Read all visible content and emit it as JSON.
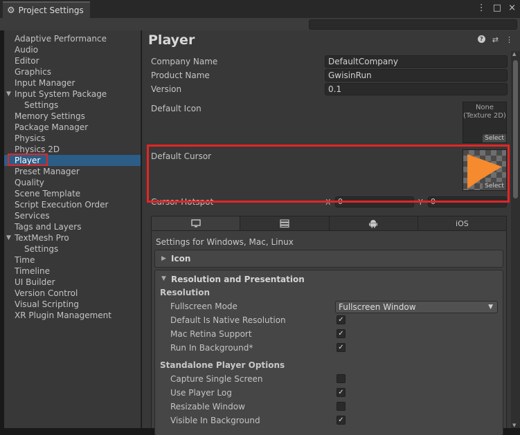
{
  "window": {
    "tab_title": "Project Settings",
    "controls": [
      "⋮",
      "□",
      "×"
    ]
  },
  "search": {
    "placeholder": ""
  },
  "sidebar": {
    "items": [
      {
        "label": "Adaptive Performance"
      },
      {
        "label": "Audio"
      },
      {
        "label": "Editor"
      },
      {
        "label": "Graphics"
      },
      {
        "label": "Input Manager"
      },
      {
        "label": "Input System Package",
        "expanded": true
      },
      {
        "label": "Settings",
        "sub": true
      },
      {
        "label": "Memory Settings"
      },
      {
        "label": "Package Manager"
      },
      {
        "label": "Physics"
      },
      {
        "label": "Physics 2D"
      },
      {
        "label": "Player",
        "selected": true
      },
      {
        "label": "Preset Manager"
      },
      {
        "label": "Quality"
      },
      {
        "label": "Scene Template"
      },
      {
        "label": "Script Execution Order"
      },
      {
        "label": "Services"
      },
      {
        "label": "Tags and Layers"
      },
      {
        "label": "TextMesh Pro",
        "expanded": true
      },
      {
        "label": "Settings",
        "sub": true
      },
      {
        "label": "Time"
      },
      {
        "label": "Timeline"
      },
      {
        "label": "UI Builder"
      },
      {
        "label": "Version Control"
      },
      {
        "label": "Visual Scripting"
      },
      {
        "label": "XR Plugin Management"
      }
    ]
  },
  "player": {
    "title": "Player",
    "company_name_label": "Company Name",
    "company_name_value": "DefaultCompany",
    "product_name_label": "Product Name",
    "product_name_value": "GwisinRun",
    "version_label": "Version",
    "version_value": "0.1",
    "default_icon_label": "Default Icon",
    "default_icon_none": "None\n(Texture 2D)",
    "select_label": "Select",
    "default_cursor_label": "Default Cursor",
    "cursor_hotspot_label": "Cursor Hotspot",
    "hotspot_x_label": "X",
    "hotspot_x_value": "0",
    "hotspot_y_label": "Y",
    "hotspot_y_value": "0"
  },
  "platform_tabs": {
    "ios_label": "iOS",
    "settings_for": "Settings for Windows, Mac, Linux"
  },
  "sections": {
    "icon_title": "Icon",
    "resolution_title": "Resolution and Presentation",
    "resolution_group": "Resolution",
    "fullscreen_mode_label": "Fullscreen Mode",
    "fullscreen_mode_value": "Fullscreen Window",
    "standalone_group": "Standalone Player Options",
    "resolution_props": [
      {
        "label": "Default Is Native Resolution",
        "checked": true
      },
      {
        "label": "Mac Retina Support",
        "checked": true
      },
      {
        "label": "Run In Background*",
        "checked": true
      }
    ],
    "standalone_props": [
      {
        "label": "Capture Single Screen",
        "checked": false
      },
      {
        "label": "Use Player Log",
        "checked": true
      },
      {
        "label": "Resizable Window",
        "checked": false
      },
      {
        "label": "Visible In Background",
        "checked": true
      }
    ]
  },
  "colors": {
    "selection": "#2c5d87",
    "highlight_red": "#e42525",
    "cursor_orange": "#f58a2e"
  }
}
